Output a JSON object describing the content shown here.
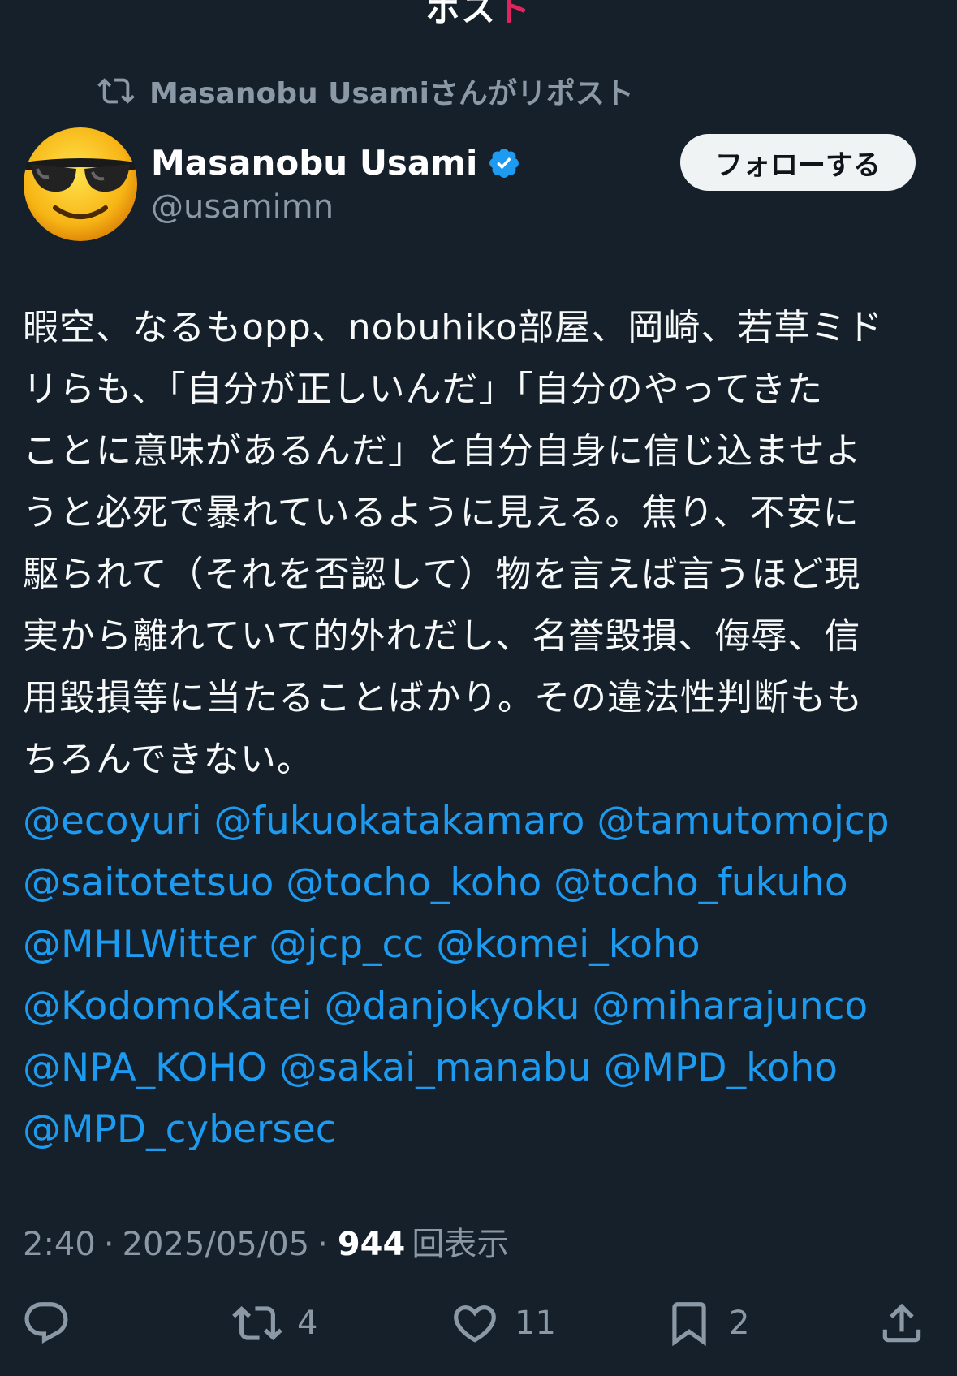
{
  "header": {
    "title": "ポスト",
    "title_main": "ポス",
    "title_accent": "ト"
  },
  "repost": {
    "text": "Masanobu Usamiさんがリポスト"
  },
  "author": {
    "display_name": "Masanobu Usami",
    "handle": "@usamimn",
    "avatar_icon": "sunglasses-emoji-icon"
  },
  "follow_button": {
    "label": "フォローする"
  },
  "post": {
    "text": "暇空、なるもopp、nobuhiko部屋、岡崎、若草ミドリらも、「自分が正しいんだ」「自分のやってきたことに意味があるんだ」と自分自身に信じ込ませようと必死で暴れているように見える。焦り、不安に駆られて（それを否認して）物を言えば言うほど現実から離れていて的外れだし、名誉毀損、侮辱、信用毀損等に当たることばかり。その違法性判断ももちろんできない。",
    "lines": [
      "暇空、なるもopp、nobuhiko部屋、岡崎、若草ミド",
      "リらも、「自分が正しいんだ」「自分のやってきた",
      "ことに意味があるんだ」と自分自身に信じ込ませよ",
      "うと必死で暴れているように見える。焦り、不安に",
      "駆られて（それを否認して）物を言えば言うほど現",
      "実から離れていて的外れだし、名誉毀損、侮辱、信",
      "用毀損等に当たることばかり。その違法性判断もも",
      "ちろんできない。"
    ],
    "mentions": [
      [
        "@ecoyuri",
        "@fukuokatakamaro",
        "@tamutomojcp"
      ],
      [
        "@saitotetsuo",
        "@tocho_koho",
        "@tocho_fukuho"
      ],
      [
        "@MHLWitter",
        "@jcp_cc",
        "@komei_koho"
      ],
      [
        "@KodomoKatei",
        "@danjokyoku",
        "@miharajunco"
      ],
      [
        "@NPA_KOHO",
        "@sakai_manabu",
        "@MPD_koho"
      ],
      [
        "@MPD_cybersec"
      ]
    ]
  },
  "meta": {
    "time": "2:40",
    "date": "2025/05/05",
    "separator": "·",
    "views_count": "944",
    "views_label": "回表示"
  },
  "actions": {
    "reply_icon": "reply-icon",
    "repost_icon": "repost-icon",
    "repost_count": "4",
    "like_icon": "heart-icon",
    "like_count": "11",
    "bookmark_icon": "bookmark-icon",
    "bookmark_count": "2",
    "share_icon": "share-icon"
  },
  "colors": {
    "background": "#15202b",
    "link": "#1d9bf0",
    "muted": "#8b98a5",
    "verified": "#1d9bf0"
  }
}
